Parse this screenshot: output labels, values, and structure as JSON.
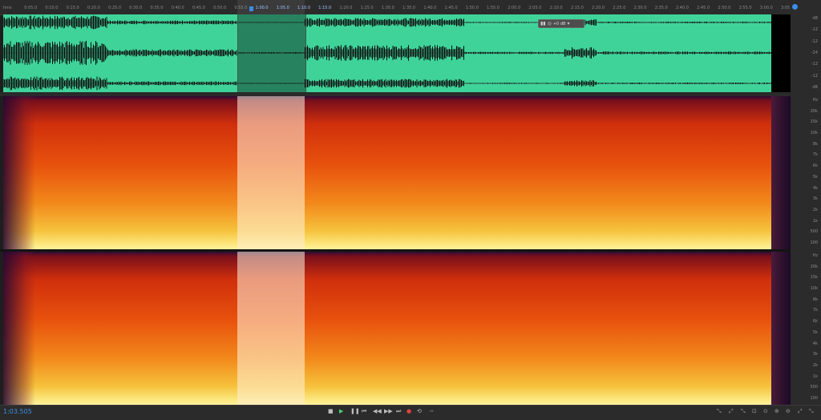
{
  "ruler": {
    "labels": [
      "hms",
      "0:05.0",
      "0:10.0",
      "0:15.0",
      "0:20.0",
      "0:25.0",
      "0:30.0",
      "0:35.0",
      "0:40.0",
      "0:45.0",
      "0:50.0",
      "0:55.0",
      "1:00.0",
      "1:05.0",
      "1:10.0",
      "1:15.0",
      "1:20.0",
      "1:25.0",
      "1:30.0",
      "1:35.0",
      "1:40.0",
      "1:45.0",
      "1:50.0",
      "1:55.0",
      "2:00.0",
      "2:05.0",
      "2:10.0",
      "2:15.0",
      "2:20.0",
      "2:25.0",
      "2:30.0",
      "2:35.0",
      "2:40.0",
      "2:45.0",
      "2:50.0",
      "2:55.0",
      "3:00.0",
      "3:05"
    ]
  },
  "hud": {
    "value": "+0 dB"
  },
  "scale": {
    "waveform": [
      "dB",
      "-12",
      "-12",
      "-24",
      "-12",
      "-12",
      "dB"
    ],
    "spectrogram": [
      "Hz",
      "20k",
      "15k",
      "10k",
      "8k",
      "7k",
      "6k",
      "5k",
      "4k",
      "3k",
      "2k",
      "1k",
      "500",
      "100"
    ]
  },
  "transport": {
    "time": "1:03.505",
    "icons": [
      "stop-icon",
      "play-icon",
      "pause-icon",
      "skip-back-icon",
      "rewind-icon",
      "fast-forward-icon",
      "skip-forward-icon",
      "record-icon",
      "loop-icon",
      "skip-selection-icon"
    ]
  },
  "colors": {
    "accent": "#3a8ee6",
    "waveform": "#3fd39a",
    "background": "#1e1e1e"
  }
}
